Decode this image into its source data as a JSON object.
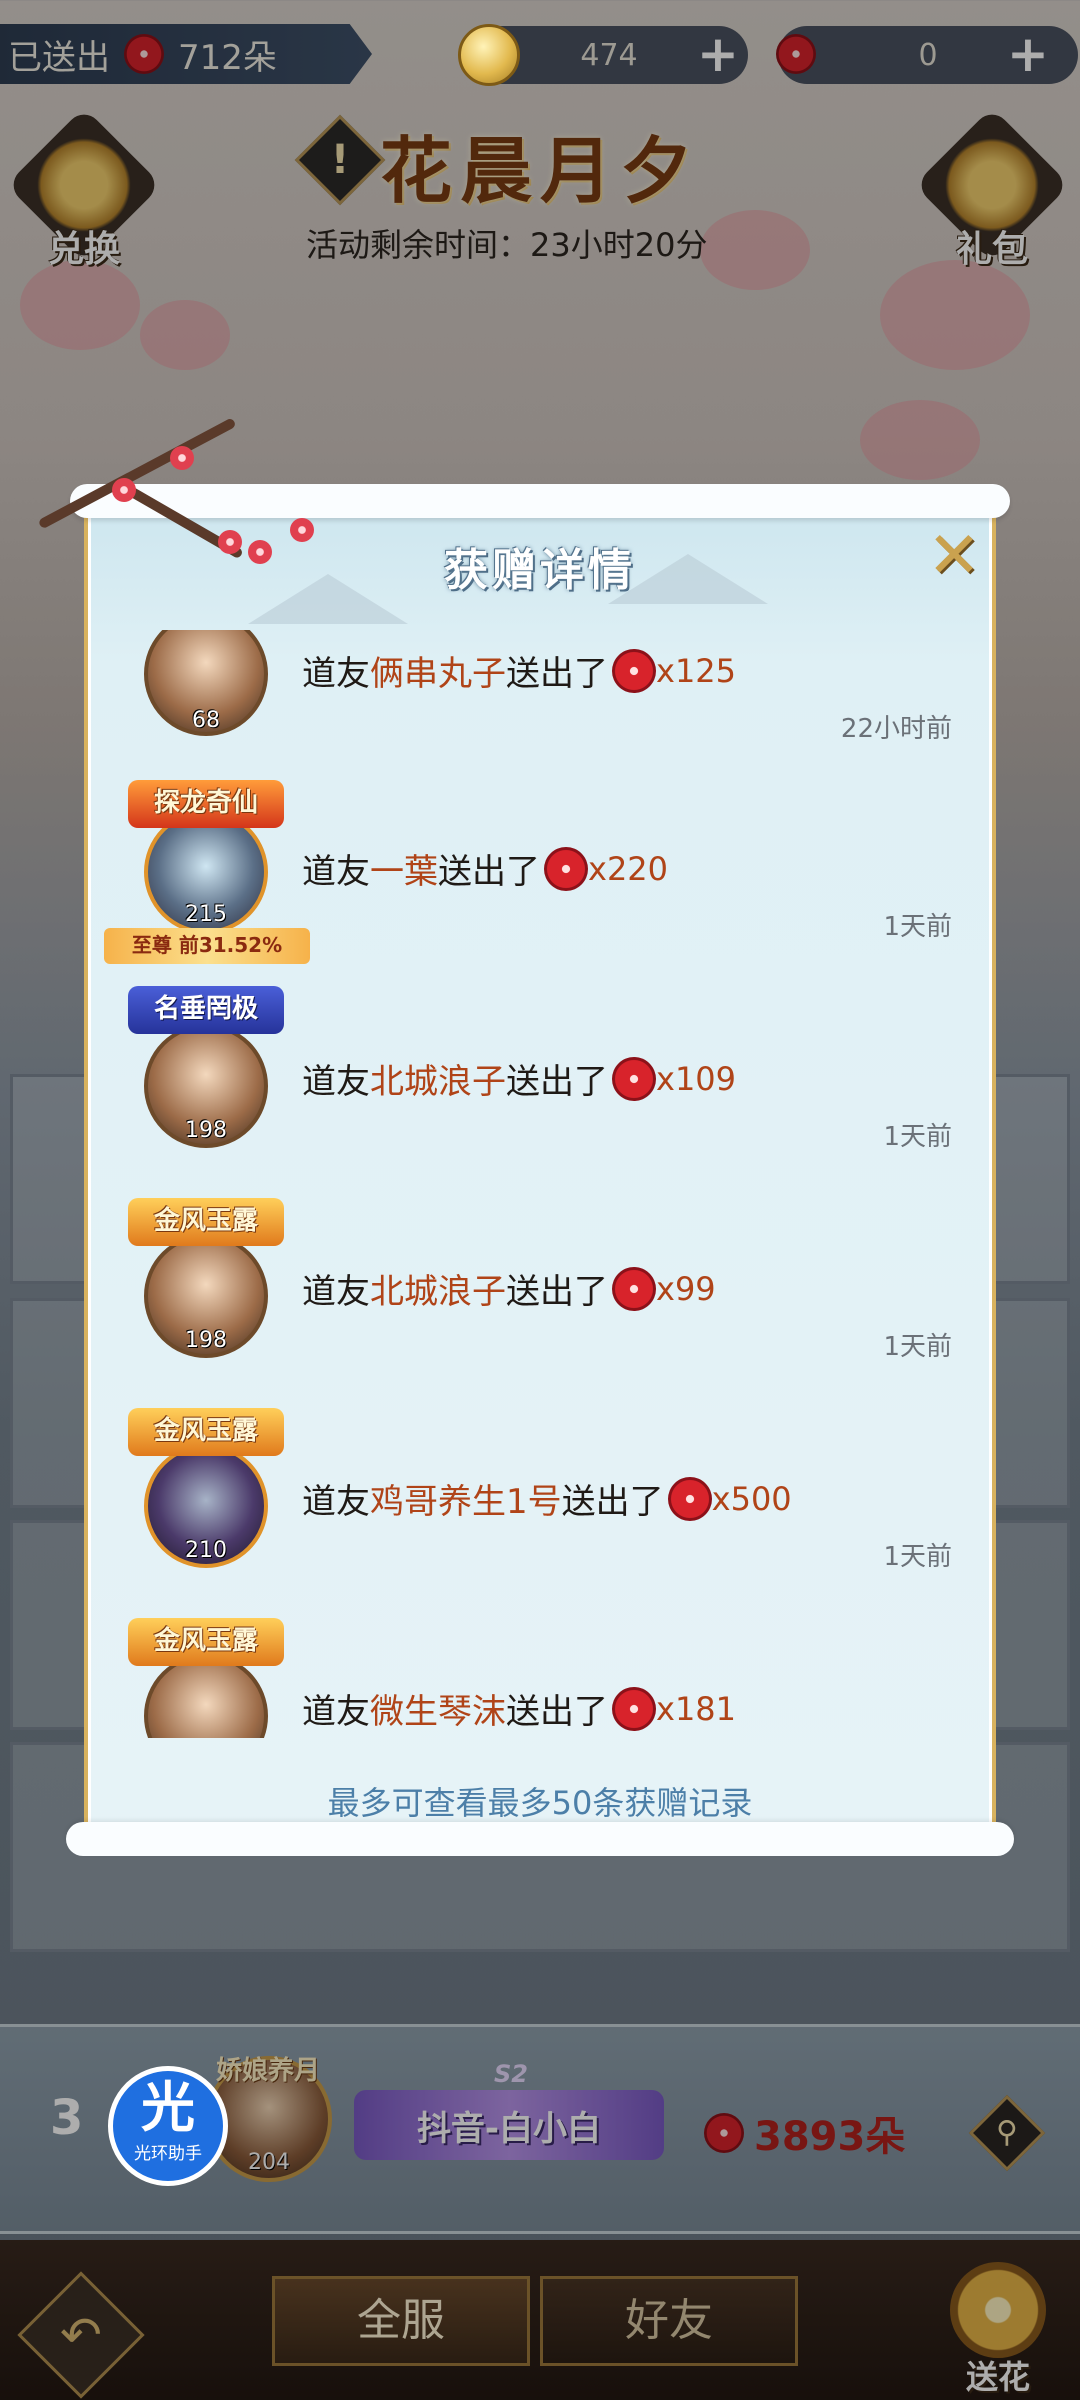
{
  "top_bar": {
    "sent_label": "已送出",
    "sent_value": "712朵",
    "coin_value": "474",
    "flower_value": "0",
    "plus": "+"
  },
  "event": {
    "title": "花晨月夕",
    "info_icon": "!",
    "time_label": "活动剩余时间：23小时20分",
    "left_button": "兑换",
    "right_button": "礼包"
  },
  "modal": {
    "title": "获赠详情",
    "close_icon": "close-icon",
    "footer": "最多可查看最多50条获赠记录",
    "entries": [
      {
        "prefix": "道友",
        "name": "俩串丸子",
        "action": "送出了",
        "qty": "x125",
        "time": "22小时前",
        "level": "68",
        "title_tag": "",
        "rank_sub": ""
      },
      {
        "prefix": "道友",
        "name": "一葉",
        "action": "送出了",
        "qty": "x220",
        "time": "1天前",
        "level": "215",
        "title_tag": "探龙奇仙",
        "rank_sub": "至尊 前31.52%"
      },
      {
        "prefix": "道友",
        "name": "北城浪子",
        "action": "送出了",
        "qty": "x109",
        "time": "1天前",
        "level": "198",
        "title_tag": "名垂罔极",
        "rank_sub": ""
      },
      {
        "prefix": "道友",
        "name": "北城浪子",
        "action": "送出了",
        "qty": "x99",
        "time": "1天前",
        "level": "198",
        "title_tag": "金风玉露",
        "rank_sub": ""
      },
      {
        "prefix": "道友",
        "name": "鸡哥养生1号",
        "action": "送出了",
        "qty": "x500",
        "time": "1天前",
        "level": "210",
        "title_tag": "金风玉露",
        "rank_sub": ""
      },
      {
        "prefix": "道友",
        "name": "微生琴沫",
        "action": "送出了",
        "qty": "x181",
        "time": "",
        "level": "",
        "title_tag": "金风玉露",
        "rank_sub": ""
      }
    ]
  },
  "my_rank": {
    "rank": "3",
    "title_tag": "娇娘养月",
    "level": "204",
    "season": "S2",
    "name": "抖音-白小白",
    "flowers": "3893朵"
  },
  "helper_badge": {
    "glyph": "光",
    "label": "光环助手"
  },
  "bottom_tabs": {
    "all_server": "全服",
    "friends": "好友",
    "send_flower": "送花",
    "back_icon": "back-arrow-icon"
  },
  "colors": {
    "accent_gold": "#d8b25e",
    "name_red": "#b04418",
    "modal_bg": "#e6f3f7",
    "footer_blue": "#4c7fa8"
  }
}
